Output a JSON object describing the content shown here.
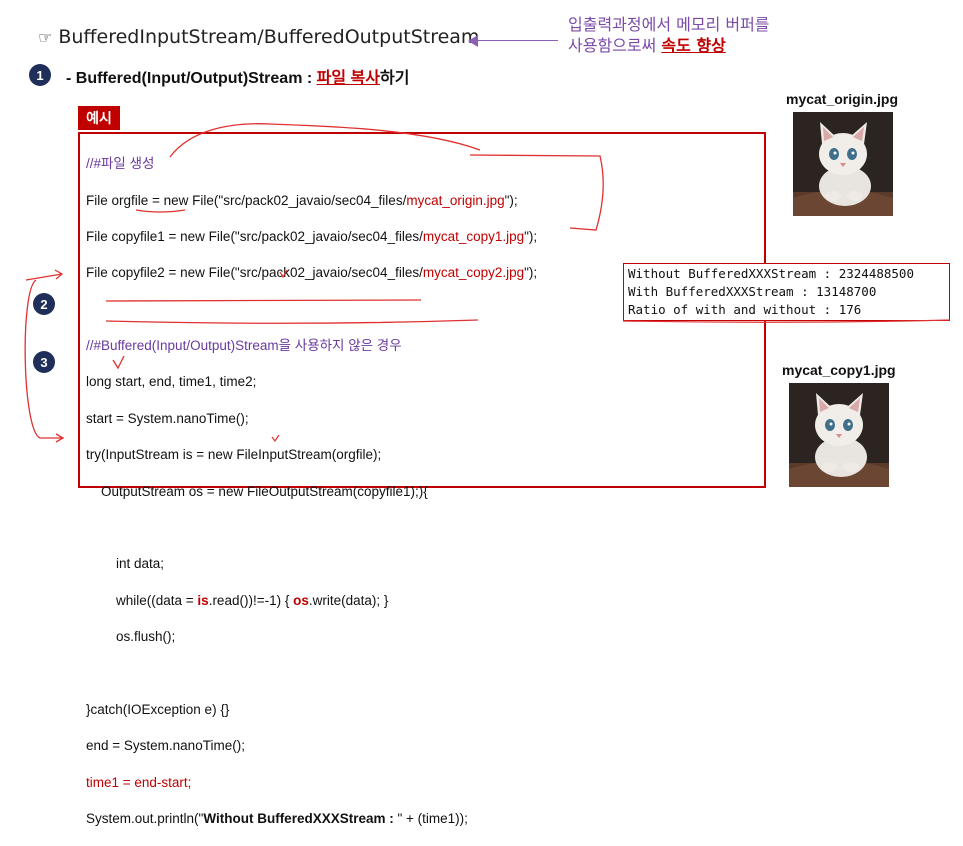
{
  "header": {
    "pointer_glyph": "☞",
    "title": "BufferedInputStream/BufferedOutputStream",
    "note_line1": "입출력과정에서 메모리 버퍼를",
    "note_line2_prefix": "사용함으로써 ",
    "note_line2_highlight": "속도 향상"
  },
  "step1": {
    "badge": "1",
    "text_prefix": "- Buffered(Input/Output)Stream : ",
    "text_highlight": "파일 복사",
    "text_suffix": "하기"
  },
  "steps": {
    "two": "2",
    "three": "3"
  },
  "example_tag": "예시",
  "code": {
    "l1": "//#파일 생성",
    "l2a": "File orgfile = new File(\"src/pack02_javaio/sec04_files/",
    "l2b": "mycat_origin.jpg",
    "l2c": "\");",
    "l3a": "File copyfile1 = new File(\"src/pack02_javaio/sec04_files/",
    "l3b": "mycat_copy1.jpg",
    "l3c": "\");",
    "l4a": "File copyfile2 = new File(\"src/pack02_javaio/sec04_files/",
    "l4b": "mycat_copy2.jpg",
    "l4c": "\");",
    "l5": "//#Buffered(Input/Output)Stream을 사용하지 않은 경우",
    "l6": "long start, end, time1, time2;",
    "l7": "start = System.nanoTime();",
    "l8": "try(InputStream is = new FileInputStream(orgfile);",
    "l9": "    OutputStream os = new FileOutputStream(copyfile1);){",
    "l10": "        int data;",
    "l11a": "        while((data = ",
    "l11b": "is",
    "l11c": ".read())!=-1) { ",
    "l11d": "os",
    "l11e": ".write(data); }",
    "l12": "        os.flush();",
    "l13": "}catch(IOException e) {}",
    "l14": "end = System.nanoTime();",
    "l15": "time1 = end-start;",
    "l16a": "System.out.println(\"",
    "l16b": "Without BufferedXXXStream : ",
    "l16c": "\" + (time1));"
  },
  "output": {
    "line1": "Without BufferedXXXStream : 2324488500",
    "line2": "With BufferedXXXStream : 13148700",
    "line3": "Ratio of with and without : 176"
  },
  "images": {
    "origin_label": "mycat_origin.jpg",
    "copy_label": "mycat_copy1.jpg"
  },
  "colors": {
    "accent_red": "#c00000",
    "comment_purple": "#6a3aa0",
    "badge_navy": "#1f2f5a"
  }
}
